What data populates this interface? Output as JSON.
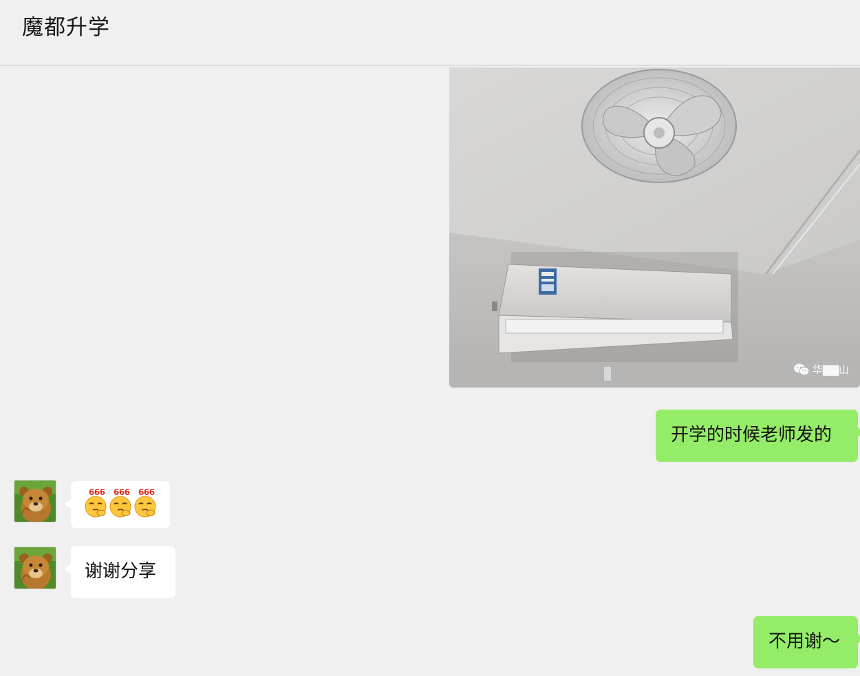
{
  "header": {
    "title": "魔都升学"
  },
  "messages": {
    "image": {
      "watermark": "华▇▇山",
      "wechat_icon": "wechat-logo-icon"
    },
    "out1": {
      "text": "开学的时候老师发的"
    },
    "in1": {
      "emoji_label": "666",
      "emoji_icon": "thinking-666-emoji",
      "count": 3
    },
    "in2": {
      "text": "谢谢分享"
    },
    "out2": {
      "text": "不用谢～"
    }
  },
  "colors": {
    "background": "#f0f0f0",
    "outgoing_bubble": "#95ec69",
    "incoming_bubble": "#ffffff",
    "title_text": "#181818"
  }
}
